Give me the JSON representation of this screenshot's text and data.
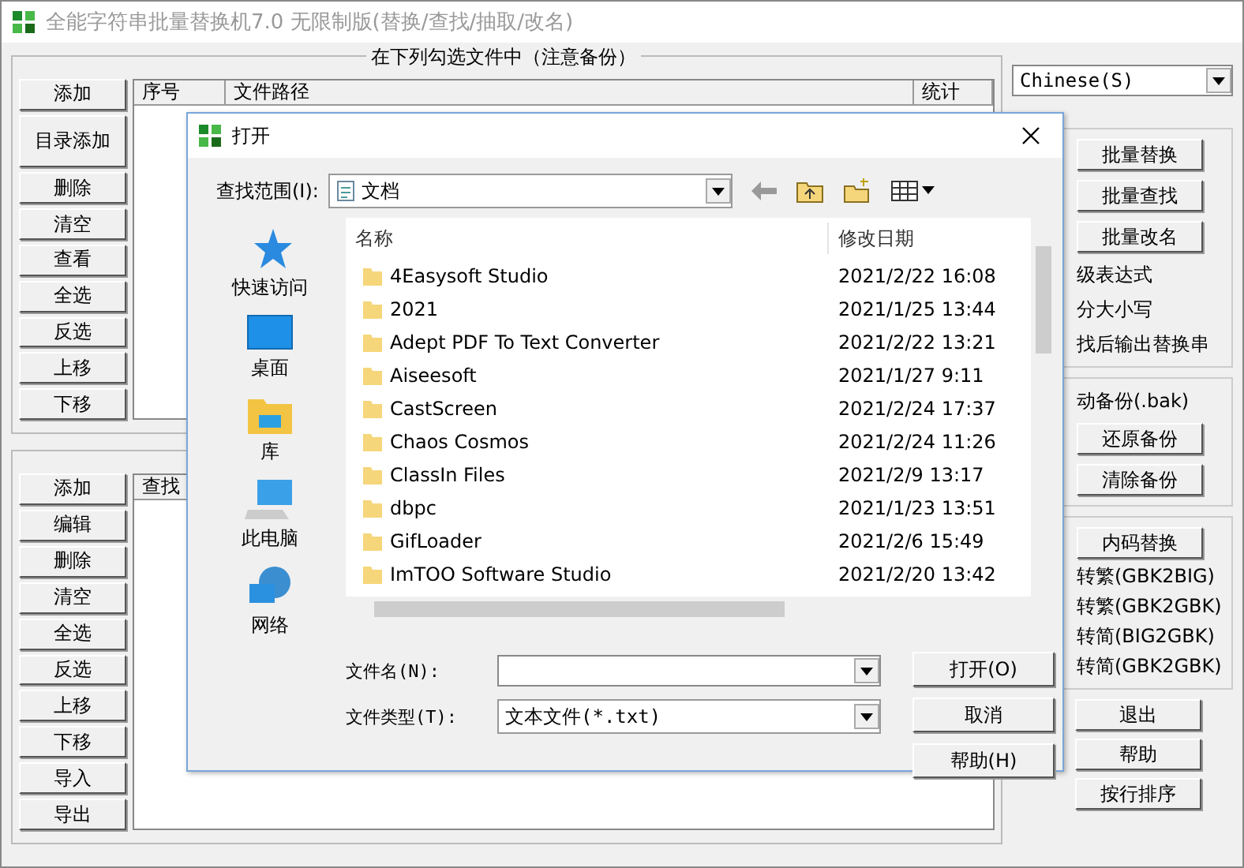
{
  "window": {
    "title": "全能字符串批量替换机7.0 无限制版(替换/查找/抽取/改名)"
  },
  "file_group": {
    "title": "在下列勾选文件中（注意备份）",
    "buttons": [
      "添加",
      "目录添加",
      "删除",
      "清空",
      "查看",
      "全选",
      "反选",
      "上移",
      "下移"
    ],
    "columns": [
      "序号",
      "文件路径",
      "统计"
    ]
  },
  "find_group": {
    "buttons": [
      "添加",
      "编辑",
      "删除",
      "清空",
      "全选",
      "反选",
      "上移",
      "下移",
      "导入",
      "导出"
    ],
    "columns": [
      "查找"
    ]
  },
  "language_select": {
    "value": "Chinese(S)"
  },
  "actions": {
    "buttons": [
      "批量替换",
      "批量查找",
      "批量改名"
    ],
    "options": [
      "级表达式",
      "分大小写",
      "找后输出替换串"
    ]
  },
  "backup": {
    "option": "动备份(.bak)",
    "buttons": [
      "还原备份",
      "清除备份"
    ]
  },
  "encoding": {
    "button": "内码替换",
    "options": [
      "转繁(GBK2BIG)",
      "转繁(GBK2GBK)",
      "转简(BIG2GBK)",
      "转简(GBK2GBK)"
    ]
  },
  "bottom_buttons": [
    "退出",
    "帮助",
    "按行排序"
  ],
  "dialog": {
    "title": "打开",
    "look_in_label": "查找范围(I):",
    "look_in_value": "文档",
    "places": [
      {
        "kind": "star",
        "label": "快速访问"
      },
      {
        "kind": "desktop",
        "label": "桌面"
      },
      {
        "kind": "library",
        "label": "库"
      },
      {
        "kind": "pc",
        "label": "此电脑"
      },
      {
        "kind": "network",
        "label": "网络"
      }
    ],
    "columns": [
      "名称",
      "修改日期"
    ],
    "files": [
      {
        "name": "4Easysoft Studio",
        "date": "2021/2/22 16:08"
      },
      {
        "name": "2021",
        "date": "2021/1/25 13:44"
      },
      {
        "name": "Adept PDF To Text Converter",
        "date": "2021/2/22 13:21"
      },
      {
        "name": "Aiseesoft",
        "date": "2021/1/27 9:11"
      },
      {
        "name": "CastScreen",
        "date": "2021/2/24 17:37"
      },
      {
        "name": "Chaos Cosmos",
        "date": "2021/2/24 11:26"
      },
      {
        "name": "ClassIn Files",
        "date": "2021/2/9 13:17"
      },
      {
        "name": "dbpc",
        "date": "2021/1/23 13:51"
      },
      {
        "name": "GifLoader",
        "date": "2021/2/6 15:49"
      },
      {
        "name": "ImTOO Software Studio",
        "date": "2021/2/20 13:42"
      }
    ],
    "file_name_label": "文件名(N):",
    "file_type_label": "文件类型(T):",
    "file_type_value": "文本文件(*.txt)",
    "buttons": [
      "打开(O)",
      "取消",
      "帮助(H)"
    ]
  }
}
